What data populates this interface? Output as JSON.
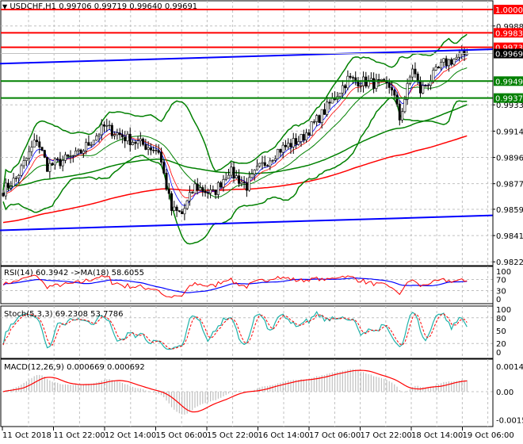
{
  "header": {
    "symbol_label": "USDCHF,H1",
    "ohlc": "0.99706 0.99719 0.99640 0.99691"
  },
  "colors": {
    "red": "#ff0000",
    "green": "#008000",
    "blue": "#0000ff",
    "teal": "#20b2aa",
    "grey": "#c0c0c0",
    "black": "#000000"
  },
  "chart_data": [
    {
      "type": "candlestick",
      "title": "USDCHF,H1",
      "bars": 180,
      "close_keypoints": [
        [
          0,
          0.98729
        ],
        [
          5,
          0.98812
        ],
        [
          13,
          0.99091
        ],
        [
          17,
          0.98896
        ],
        [
          29,
          0.9898
        ],
        [
          39,
          0.99175
        ],
        [
          48,
          0.99091
        ],
        [
          60,
          0.99008
        ],
        [
          65,
          0.98589
        ],
        [
          69,
          0.98561
        ],
        [
          74,
          0.98757
        ],
        [
          81,
          0.98701
        ],
        [
          87,
          0.98868
        ],
        [
          94,
          0.98757
        ],
        [
          98,
          0.98868
        ],
        [
          106,
          0.99008
        ],
        [
          115,
          0.99091
        ],
        [
          124,
          0.99287
        ],
        [
          133,
          0.9951
        ],
        [
          143,
          0.99482
        ],
        [
          150,
          0.99454
        ],
        [
          153,
          0.99231
        ],
        [
          158,
          0.99594
        ],
        [
          161,
          0.99426
        ],
        [
          170,
          0.99622
        ],
        [
          179,
          0.99691
        ]
      ],
      "ylim": [
        0.98225,
        1.00001
      ],
      "price_ticks": [
        "0.99885",
        "0.99330",
        "0.99145",
        "0.98960",
        "0.98775",
        "0.98595",
        "0.98410",
        "0.98225"
      ],
      "levels": [
        {
          "value": 1.00001,
          "label": "1.00001",
          "color": "#ff0000"
        },
        {
          "value": 0.99837,
          "label": "0.99837",
          "color": "#ff0000"
        },
        {
          "value": 0.99735,
          "label": "0.99735",
          "color": "#ff0000"
        },
        {
          "value": 0.99497,
          "label": "0.99497",
          "color": "#008000"
        },
        {
          "value": 0.99378,
          "label": "0.99378",
          "color": "#008000"
        }
      ],
      "current_price": {
        "value": 0.99691,
        "label": "0.99691"
      },
      "trendlines": [
        {
          "from": [
            0,
            0.9962
          ],
          "to": [
            189,
            0.99721
          ],
          "color": "#0000ff"
        },
        {
          "from": [
            0,
            0.98447
          ],
          "to": [
            189,
            0.98552
          ],
          "color": "#0000ff"
        }
      ],
      "x_labels": [
        "11 Oct 2018",
        "11 Oct 22:00",
        "12 Oct 14:00",
        "15 Oct 06:00",
        "15 Oct 22:00",
        "16 Oct 14:00",
        "17 Oct 06:00",
        "17 Oct 22:00",
        "18 Oct 14:00",
        "19 Oct 06:00"
      ]
    },
    {
      "type": "line",
      "title": "RSI(14) 60.3942  ->MA(18) 58.6055",
      "ticks": [
        "100",
        "70",
        "30",
        "0"
      ],
      "ylim": [
        0,
        100
      ]
    },
    {
      "type": "line",
      "title": "Stoch(5,3,3) 69.2308 53.7786",
      "ticks": [
        "100",
        "80",
        "50",
        "20",
        "0"
      ],
      "ylim": [
        0,
        100
      ]
    },
    {
      "type": "bar",
      "title": "MACD(12,26,9) 0.000669 0.000692",
      "ticks": [
        "0.001419",
        "0.00",
        "-0.001564"
      ],
      "ylim": [
        -0.001564,
        0.001419
      ]
    }
  ]
}
